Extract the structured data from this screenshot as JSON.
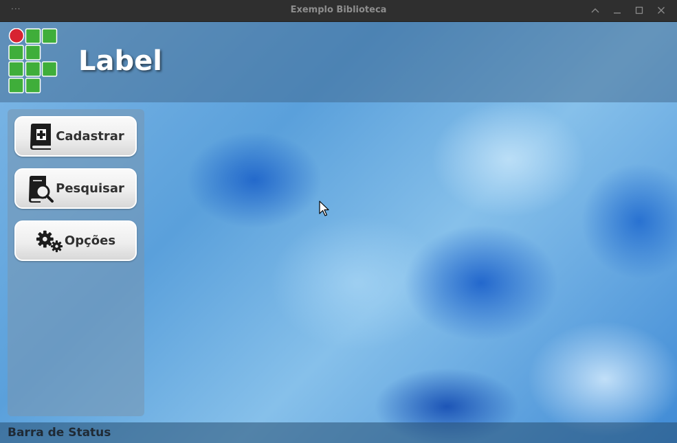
{
  "window": {
    "title": "Exemplo Biblioteca",
    "menu_glyph": "···",
    "controls": [
      "chevron-up-icon",
      "minimize-icon",
      "maximize-icon",
      "close-icon"
    ]
  },
  "header": {
    "logo_icon": "ifpb-logo-icon",
    "label": "Label"
  },
  "sidebar": {
    "buttons": [
      {
        "label": "Cadastrar",
        "icon": "book-add-icon"
      },
      {
        "label": "Pesquisar",
        "icon": "book-search-icon"
      },
      {
        "label": "Opções",
        "icon": "gears-icon"
      }
    ]
  },
  "statusbar": {
    "text": "Barra de Status"
  },
  "colors": {
    "logo_green": "#3fae3a",
    "logo_red": "#d72331",
    "titlebar_bg": "#2f2f2f",
    "button_text": "#303030"
  }
}
